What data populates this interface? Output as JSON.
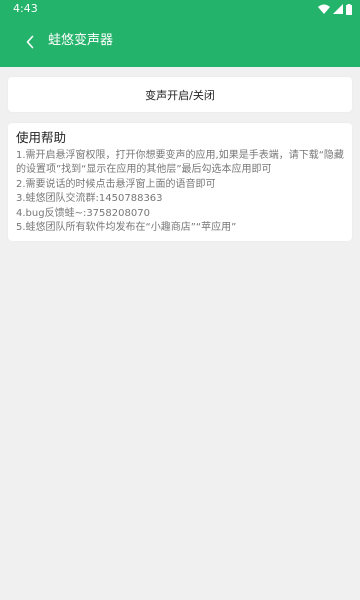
{
  "status_bar": {
    "time": "4:43"
  },
  "header": {
    "title": "蛙悠变声器",
    "back_icon": "chevron-left-icon",
    "background": "#24b36b"
  },
  "toggle_card": {
    "label": "变声开启/关闭"
  },
  "help": {
    "title": "使用帮助",
    "lines": [
      "1.需开启悬浮窗权限，打开你想要变声的应用,如果是手表端，请下载“隐藏的设置项”找到“显示在应用的其他层”最后勾选本应用即可",
      "2.需要说话的时候点击悬浮窗上面的语音即可",
      "3.蛙悠团队交流群:1450788363",
      "4.bug反馈蛙~:3758208070",
      "5.蛙悠团队所有软件均发布在“小趣商店”“苹应用”"
    ]
  }
}
